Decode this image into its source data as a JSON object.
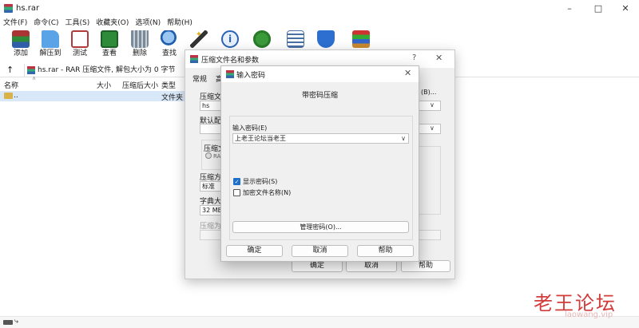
{
  "window": {
    "title": "hs.rar",
    "controls": [
      "minimize-icon",
      "maximize-icon",
      "close-icon"
    ]
  },
  "menu": [
    "文件(F)",
    "命令(C)",
    "工具(S)",
    "收藏夹(O)",
    "选项(N)",
    "帮助(H)"
  ],
  "toolbar": [
    {
      "label": "添加",
      "icon": "add-archive-icon",
      "color": "#c0392b"
    },
    {
      "label": "解压到",
      "icon": "extract-folder-icon",
      "color": "#3b82c4"
    },
    {
      "label": "测试",
      "icon": "test-checklist-icon",
      "color": "#b33a3a"
    },
    {
      "label": "查看",
      "icon": "view-book-icon",
      "color": "#2e8b3a"
    },
    {
      "label": "删除",
      "icon": "trash-icon",
      "color": "#6b7a8a"
    },
    {
      "label": "查找",
      "icon": "magnifier-icon",
      "color": "#1f5fae"
    },
    {
      "label": "",
      "icon": "wizard-wand-icon",
      "color": "#e0b020"
    },
    {
      "label": "",
      "icon": "info-icon",
      "color": "#2a62b8"
    },
    {
      "label": "",
      "icon": "virus-scan-icon",
      "color": "#3a9a3a"
    },
    {
      "label": "",
      "icon": "comment-icon",
      "color": "#4a6fa5"
    },
    {
      "label": "",
      "icon": "shield-icon",
      "color": "#2c6fd0"
    },
    {
      "label": "",
      "icon": "sfx-box-icon",
      "color": "#c9892e"
    }
  ],
  "address": {
    "text": "hs.rar - RAR 压缩文件, 解包大小为 0 字节"
  },
  "filelist": {
    "columns": [
      "名称",
      "大小",
      "压缩后大小",
      "类型"
    ],
    "rows": [
      {
        "name": "..",
        "type": "文件夹"
      }
    ]
  },
  "dialog_archive": {
    "title": "压缩文件名和参数",
    "help": "?",
    "tabs": [
      "常规",
      "高"
    ],
    "labels": {
      "archive_name": "压缩文",
      "default_profile": "默认配",
      "format": "压缩文",
      "rar": "RAR",
      "method": "压缩方",
      "dict": "字典大",
      "split": "压缩为"
    },
    "values": {
      "name": "hs",
      "method": "标准",
      "dict": "32 MB",
      "browse": "(B)..."
    },
    "buttons": {
      "ok": "确定",
      "cancel": "取消",
      "help": "帮助"
    }
  },
  "dialog_password": {
    "title": "输入密码",
    "heading": "带密码压缩",
    "password_label": "输入密码(E)",
    "password_value": "上老王论坛当老王",
    "show_password": "显示密码(S)",
    "show_password_checked": true,
    "encrypt_names": "加密文件名称(N)",
    "encrypt_names_checked": false,
    "manage_button": "管理密码(O)...",
    "buttons": {
      "ok": "确定",
      "cancel": "取消",
      "help": "帮助"
    }
  },
  "watermark": {
    "cn": "老王论坛",
    "url": "laowang.vip"
  }
}
